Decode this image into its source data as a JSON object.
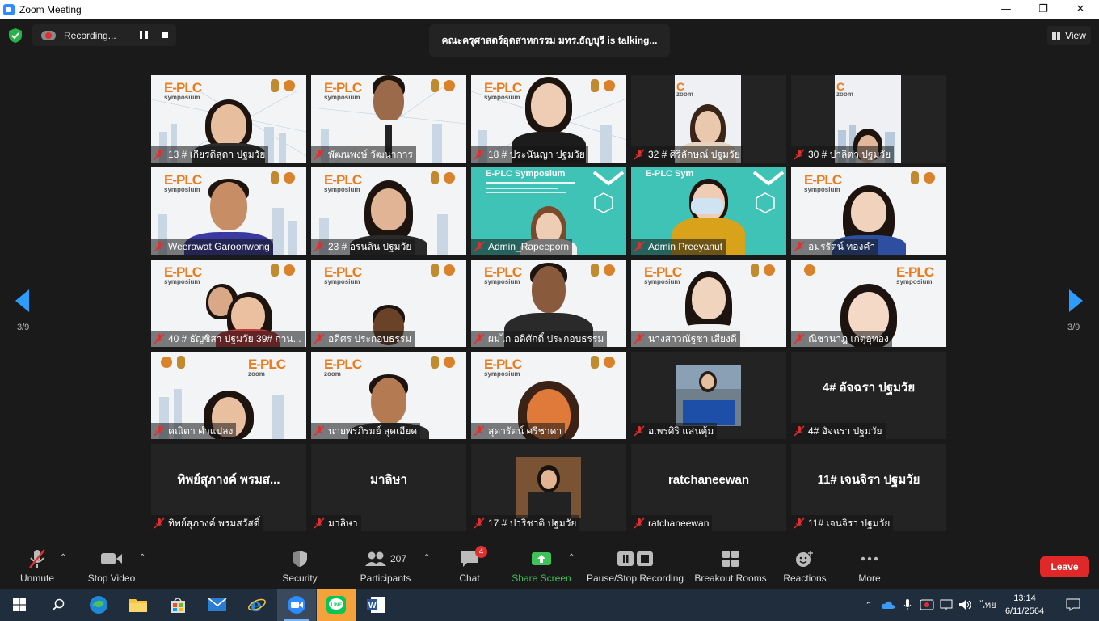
{
  "window": {
    "title": "Zoom Meeting"
  },
  "top": {
    "recording_label": "Recording...",
    "talking_text": "คณะครุศาสตร์อุตสาหกรรม มทร.ธัญบุรี is  talking...",
    "view_label": "View",
    "page_left": "3/9",
    "page_right": "3/9"
  },
  "tiles": [
    {
      "name": "13 # เกียรติสุดา ปฐมวัย"
    },
    {
      "name": "พัฒนพงษ์ วัฒนาการ"
    },
    {
      "name": "18 # ประนันญา ปฐมวัย"
    },
    {
      "name": "32 # ศิริลักษณ์ ปฐมวัย"
    },
    {
      "name": "30 # ปาลิตา ปฐมวัย"
    },
    {
      "name": "Weerawat Garoonwong"
    },
    {
      "name": "23 # อรนลิน ปฐมวัย"
    },
    {
      "name": "Admin_Rapeeporn"
    },
    {
      "name": "Admin Preeyanut"
    },
    {
      "name": "อมรรัตน์ ทองคำ"
    },
    {
      "name": "40 # ธัญชิสา ปฐมวัย 39# กาน..."
    },
    {
      "name": "อดิศร ประกอบธรรม"
    },
    {
      "name": "ผมไก อดิศักดิ์ ประกอบธรรม"
    },
    {
      "name": "นางสาวณัฐชา เสียงดี"
    },
    {
      "name": "ณิชานาฎ เกตุอุทอง"
    },
    {
      "name": "คณิตา  คำแปลง"
    },
    {
      "name": "นายพรภิรมย์ สุดเอียด"
    },
    {
      "name": "สุดารัตน์ ศรีชาดา"
    },
    {
      "name": "อ.พรศิริ แสนตุ้ม"
    },
    {
      "name": "4# อัจฉรา ปฐมวัย",
      "big": "4# อัจฉรา ปฐมวัย"
    },
    {
      "name": "ทิพย์สุภางค์ พรมสวัสดิ์",
      "big": "ทิพย์สุภางค์ พรมส..."
    },
    {
      "name": "มาลิษา",
      "big": "มาลิษา"
    },
    {
      "name": "17 # ปาริชาติ ปฐมวัย"
    },
    {
      "name": "ratchaneewan",
      "big": "ratchaneewan"
    },
    {
      "name": "11# เจนจิรา ปฐมวัย",
      "big": "11# เจนจิรา ปฐมวัย"
    }
  ],
  "toolbar": {
    "unmute": "Unmute",
    "stop_video": "Stop Video",
    "security": "Security",
    "participants": "Participants",
    "participants_count": "207",
    "chat": "Chat",
    "chat_badge": "4",
    "share_screen": "Share Screen",
    "recording": "Pause/Stop Recording",
    "breakout": "Breakout Rooms",
    "reactions": "Reactions",
    "more": "More",
    "leave": "Leave"
  },
  "taskbar": {
    "lang": "ไทย",
    "time": "13:14",
    "date": "6/11/2564"
  },
  "colors": {
    "accent": "#2d8cff",
    "share_green": "#3ec35a",
    "leave_red": "#e02828",
    "badge_red": "#e02f2f",
    "tile_bg": "#232323"
  }
}
